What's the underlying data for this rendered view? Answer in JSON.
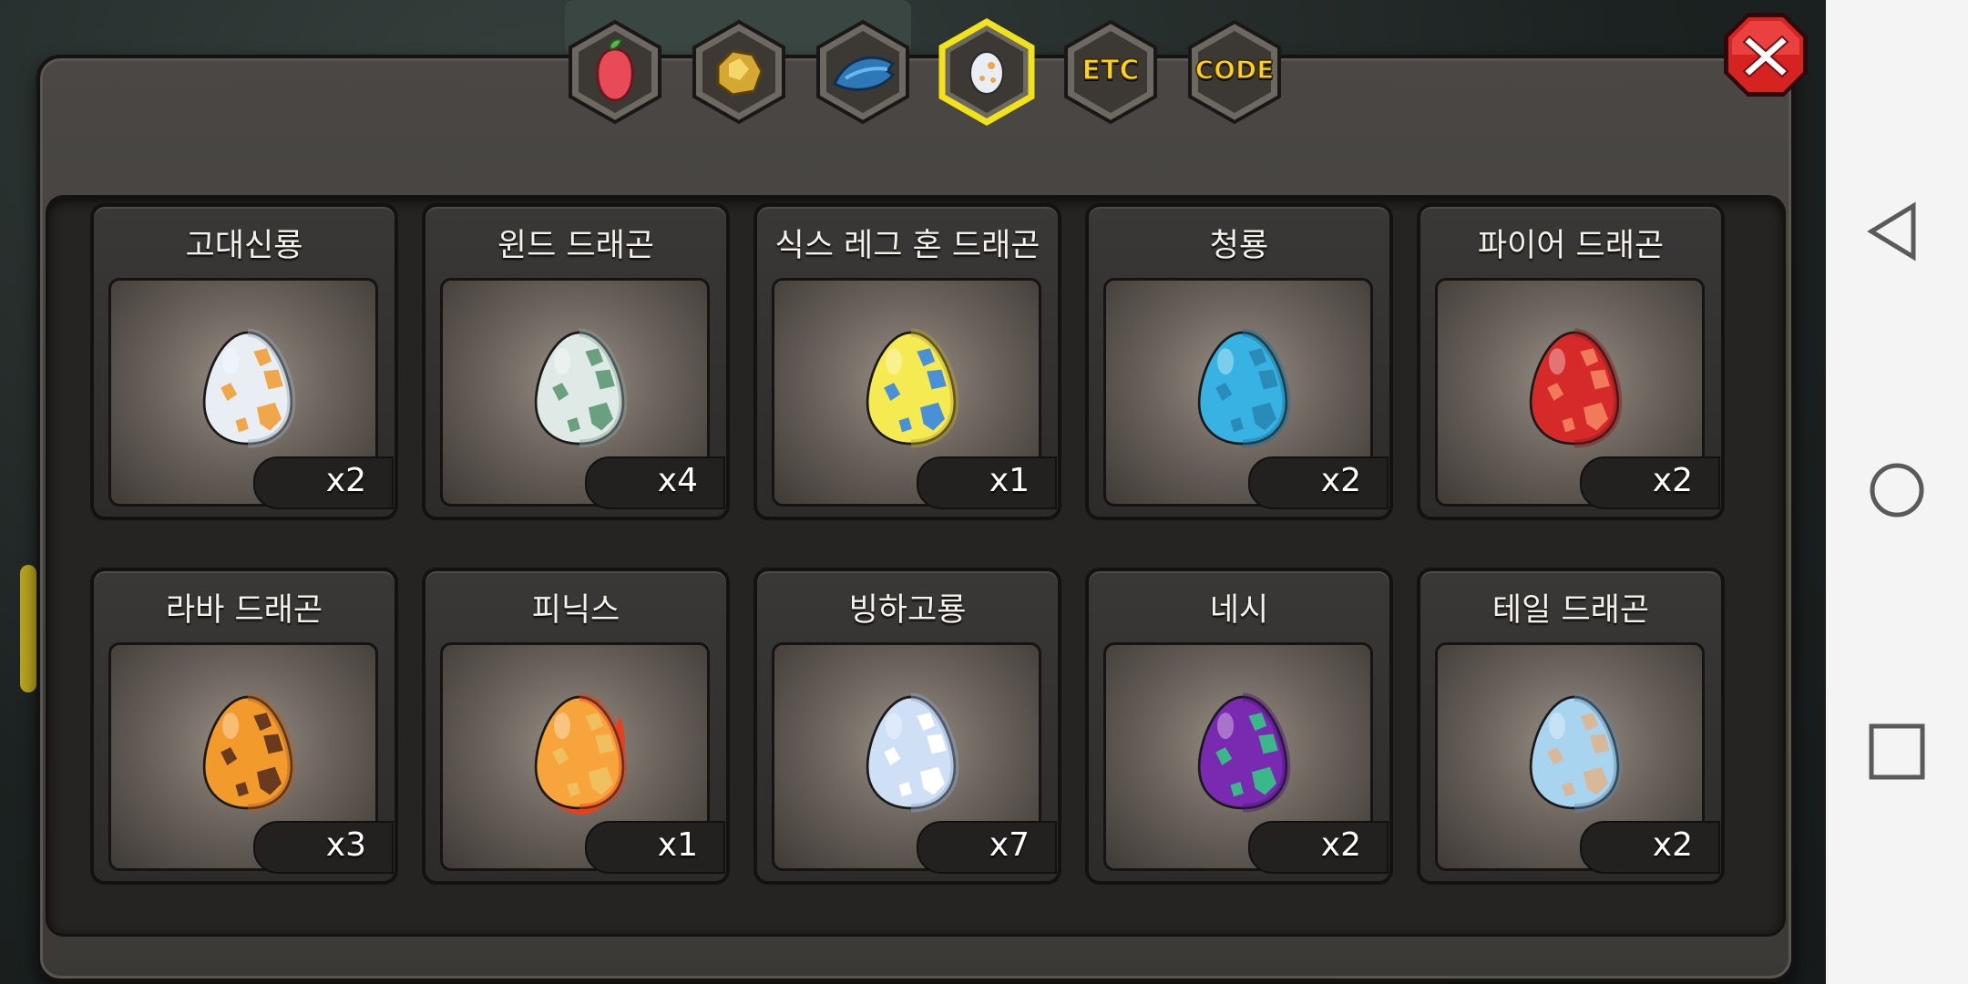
{
  "tabs": [
    {
      "name": "fruit-tab",
      "icon": "fruit-icon",
      "label": ""
    },
    {
      "name": "gold-tab",
      "icon": "gold-nugget-icon",
      "label": ""
    },
    {
      "name": "fish-tab",
      "icon": "fish-icon",
      "label": ""
    },
    {
      "name": "egg-tab",
      "icon": "egg-icon",
      "label": "",
      "selected": true
    },
    {
      "name": "etc-tab",
      "icon": "etc-text-icon",
      "label": "ETC"
    },
    {
      "name": "code-tab",
      "icon": "code-text-icon",
      "label": "CODE"
    }
  ],
  "close_icon": "close-icon",
  "eggs": [
    {
      "title": "고대신룡",
      "qty": "x2",
      "base": "#e8eef4",
      "spot": "#f0a64a",
      "edge": "#9aa6b4"
    },
    {
      "title": "윈드 드래곤",
      "qty": "x4",
      "base": "#dfeae6",
      "spot": "#6aa080",
      "edge": "#8aa4a0"
    },
    {
      "title": "식스 레그 혼 드래곤",
      "qty": "x1",
      "base": "#f6ea52",
      "spot": "#4a90d8",
      "edge": "#b8a42a"
    },
    {
      "title": "청룡",
      "qty": "x2",
      "base": "#37b2e2",
      "spot": "#2a8ab8",
      "edge": "#1d6f96"
    },
    {
      "title": "파이어 드래곤",
      "qty": "x2",
      "base": "#d62a2a",
      "spot": "#f07a5a",
      "edge": "#8a1616"
    },
    {
      "title": "라바 드래곤",
      "qty": "x3",
      "base": "#f39a2c",
      "spot": "#6a3a20",
      "edge": "#b4601a"
    },
    {
      "title": "피닉스",
      "qty": "x1",
      "base": "#f7a43c",
      "spot": "#f0c060",
      "edge": "#e0401a",
      "flame": true
    },
    {
      "title": "빙하고룡",
      "qty": "x7",
      "base": "#cfe0f6",
      "spot": "#ffffff",
      "edge": "#8ea6c4"
    },
    {
      "title": "네시",
      "qty": "x2",
      "base": "#7a2ab0",
      "spot": "#3ab88a",
      "edge": "#4a1478"
    },
    {
      "title": "테일 드래곤",
      "qty": "x2",
      "base": "#a8d4f0",
      "spot": "#d8b898",
      "edge": "#5e8aa8"
    }
  ],
  "navbar": {
    "back": "back-triangle-icon",
    "home": "home-circle-icon",
    "recents": "recents-square-icon"
  }
}
